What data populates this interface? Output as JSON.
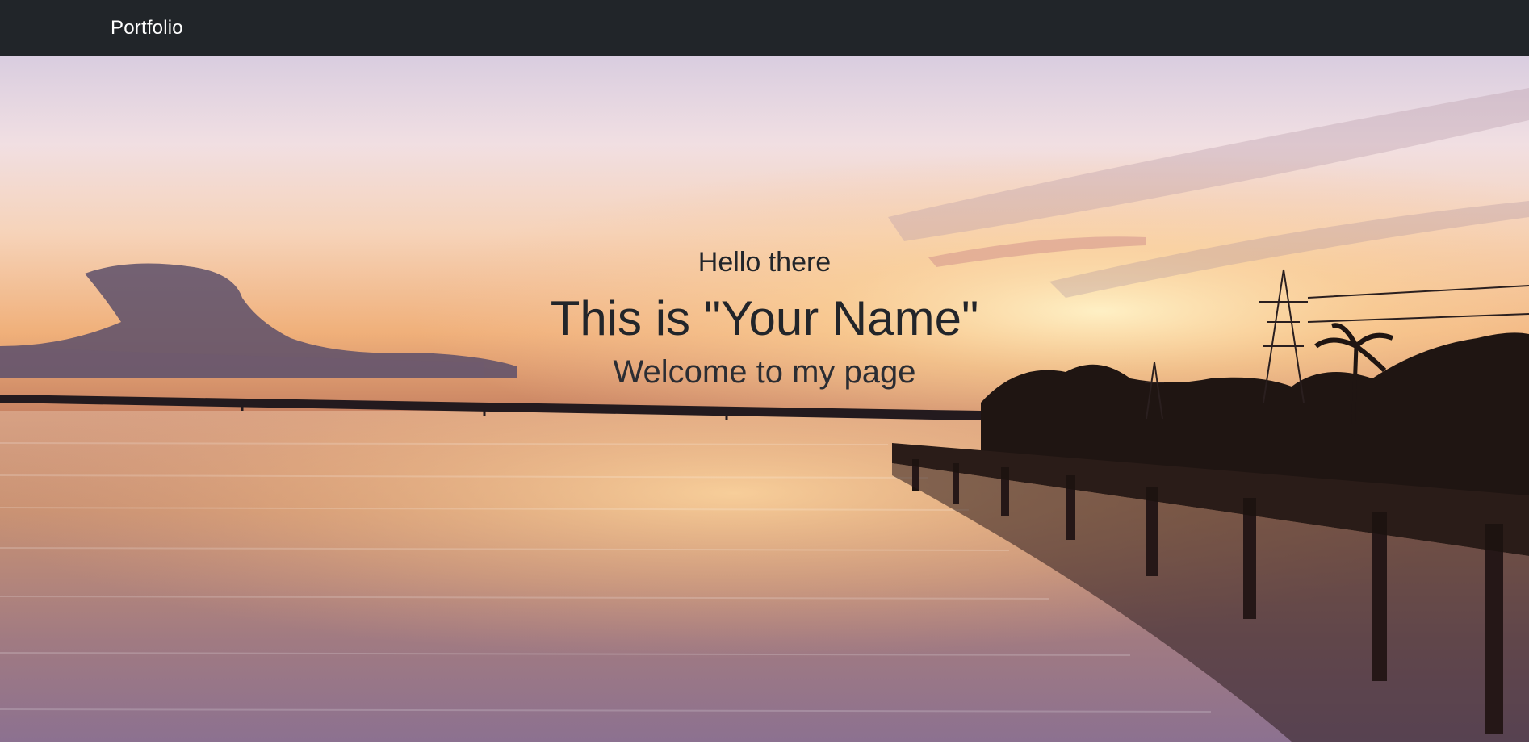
{
  "navbar": {
    "brand": "Portfolio"
  },
  "hero": {
    "greeting": "Hello there",
    "name": "This is \"Your Name\"",
    "tagline": "Welcome to my page",
    "background_description_icon": "sunset-lake-photo",
    "colors": {
      "navbar_bg": "#212529",
      "brand_text": "#ffffff",
      "hero_text": "#22252a"
    }
  }
}
